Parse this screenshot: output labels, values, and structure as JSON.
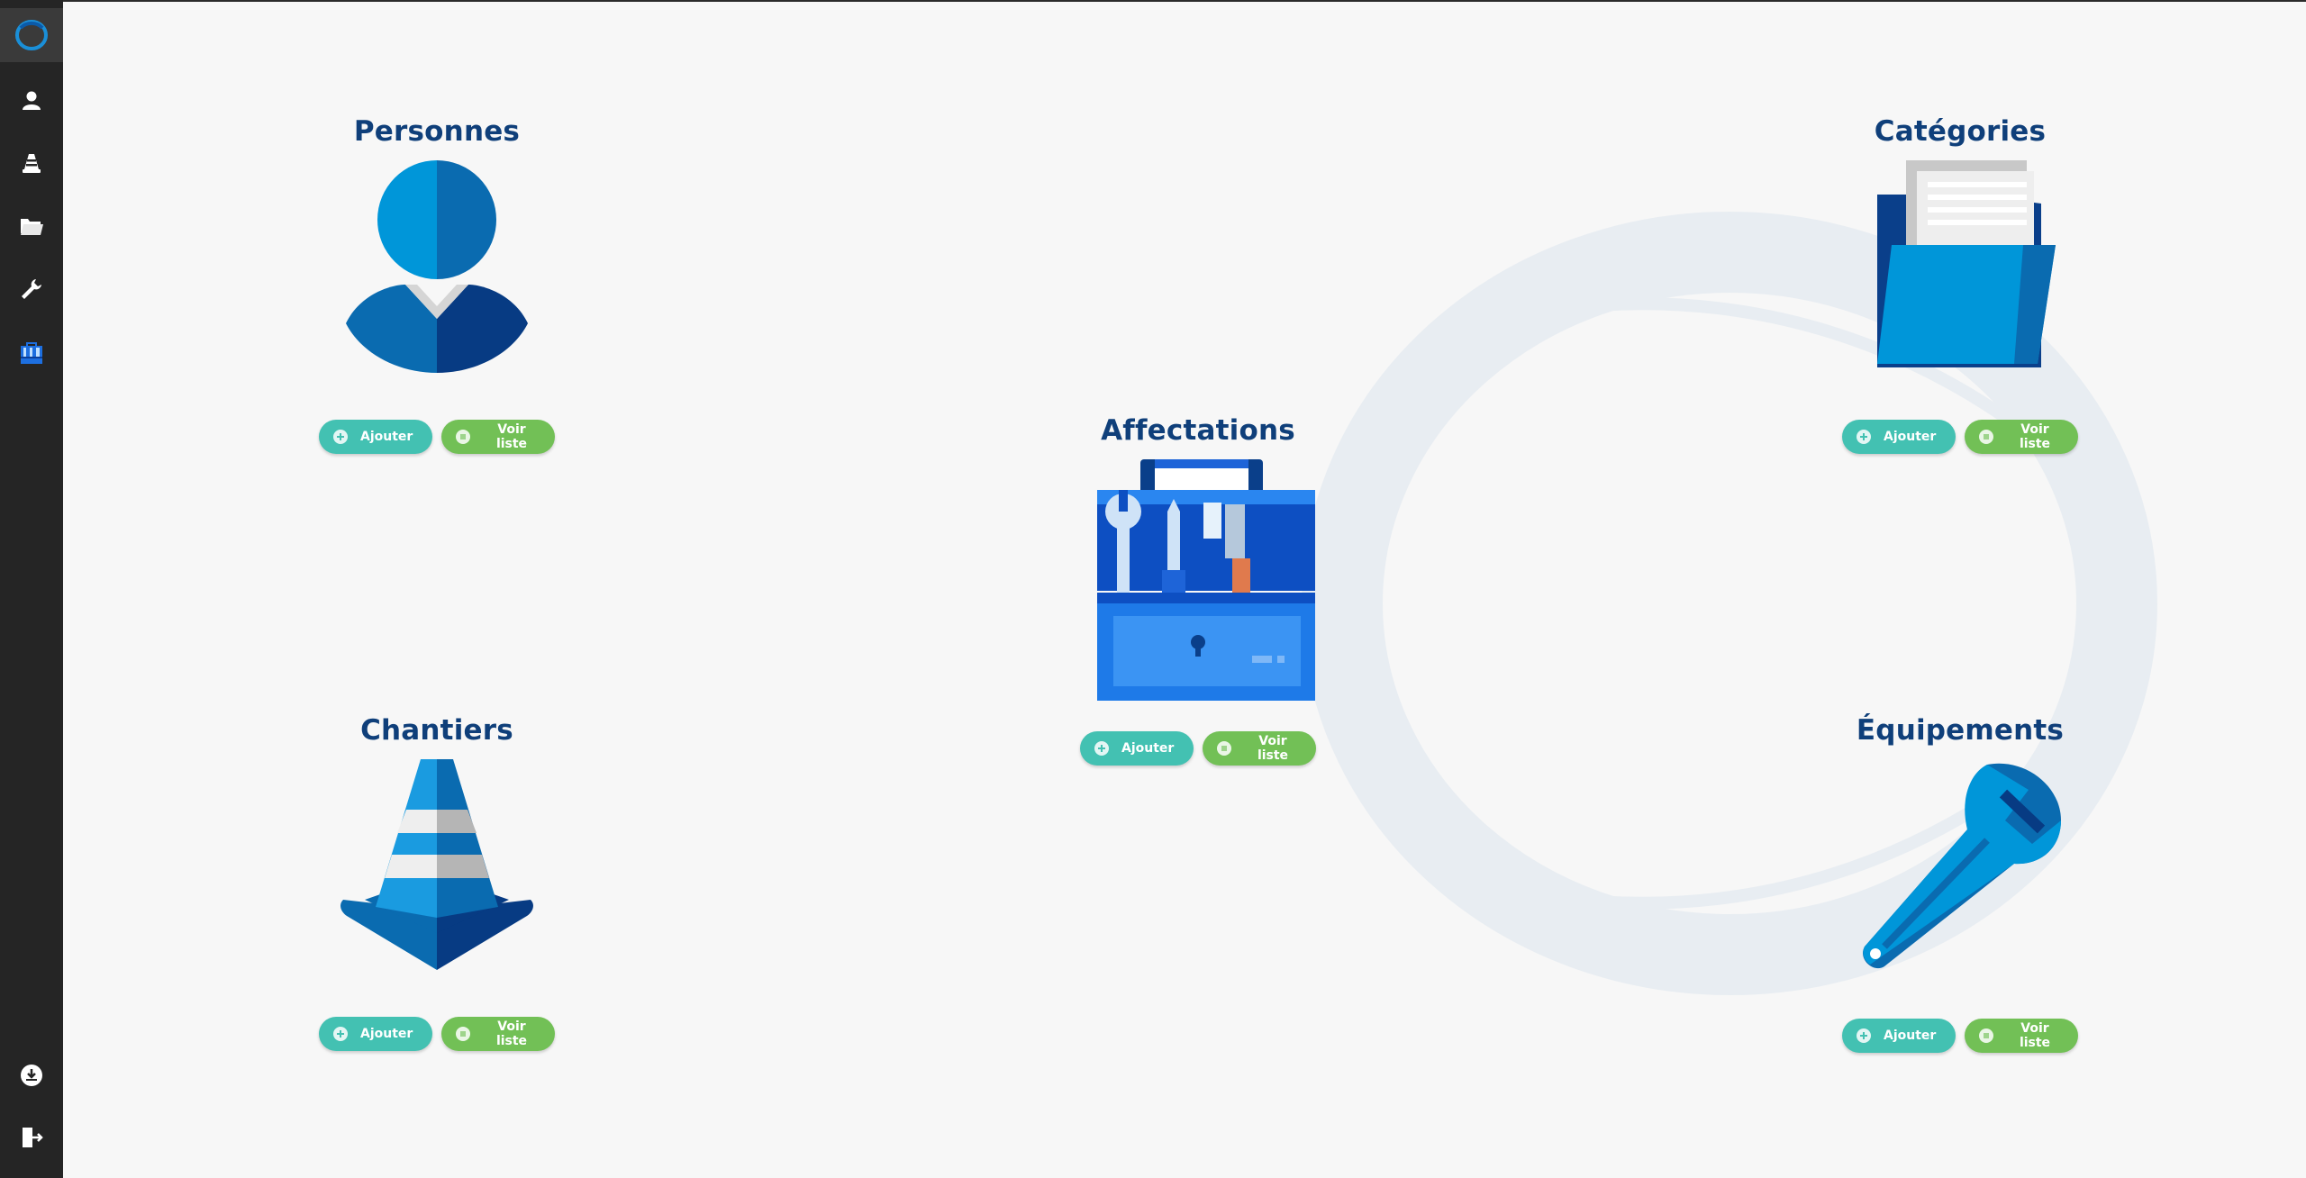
{
  "sidebar": {
    "items": [
      {
        "icon": "app-logo-icon"
      },
      {
        "icon": "user-icon"
      },
      {
        "icon": "traffic-cone-icon"
      },
      {
        "icon": "folder-icon"
      },
      {
        "icon": "wrench-icon"
      },
      {
        "icon": "toolbox-icon"
      }
    ],
    "bottom": [
      {
        "icon": "download-icon"
      },
      {
        "icon": "logout-icon"
      }
    ]
  },
  "tiles": {
    "personnes": {
      "title": "Personnes",
      "add": "Ajouter",
      "list": "Voir liste",
      "icon": "person-icon"
    },
    "categories": {
      "title": "Catégories",
      "add": "Ajouter",
      "list": "Voir liste",
      "icon": "folder-documents-icon"
    },
    "affectations": {
      "title": "Affectations",
      "add": "Ajouter",
      "list": "Voir liste",
      "icon": "toolbox-icon"
    },
    "chantiers": {
      "title": "Chantiers",
      "add": "Ajouter",
      "list": "Voir liste",
      "icon": "traffic-cone-icon"
    },
    "equipements": {
      "title": "Équipements",
      "add": "Ajouter",
      "list": "Voir liste",
      "icon": "wrench-icon"
    }
  },
  "colors": {
    "title": "#0f3f7a",
    "add_button": "#43c1b2",
    "list_button": "#72c056",
    "sidebar": "#252525"
  }
}
